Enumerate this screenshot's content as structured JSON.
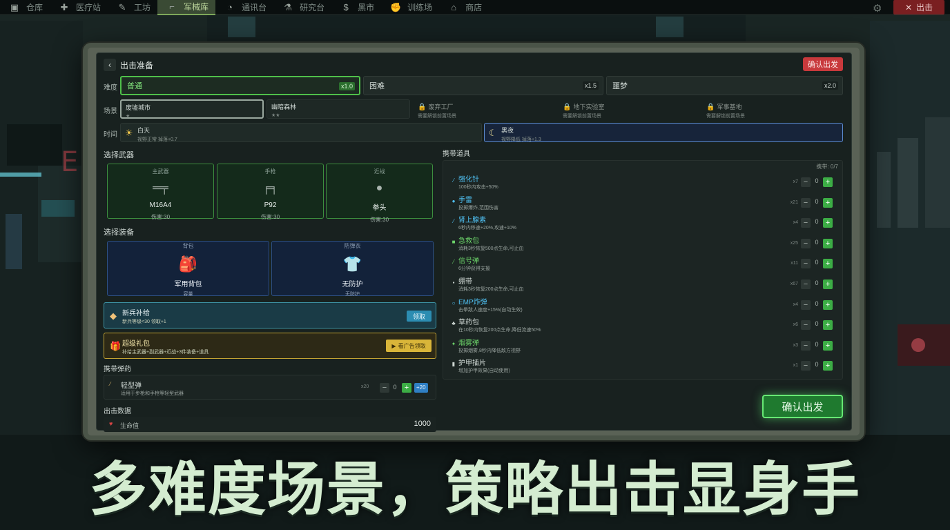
{
  "nav": {
    "items": [
      {
        "label": "仓库",
        "icon": "box-icon",
        "glyph": "▣"
      },
      {
        "label": "医疗站",
        "icon": "medical-bag-icon",
        "glyph": "✚"
      },
      {
        "label": "工坊",
        "icon": "wrench-icon",
        "glyph": "✎"
      },
      {
        "label": "军械库",
        "icon": "rifle-icon",
        "glyph": "⌐"
      },
      {
        "label": "通讯台",
        "icon": "satellite-dish-icon",
        "glyph": "◔"
      },
      {
        "label": "研究台",
        "icon": "microscope-icon",
        "glyph": "⚗"
      },
      {
        "label": "黑市",
        "icon": "money-bag-icon",
        "glyph": "$"
      },
      {
        "label": "训练场",
        "icon": "muscle-arm-icon",
        "glyph": "✊"
      },
      {
        "label": "商店",
        "icon": "shop-icon",
        "glyph": "⌂"
      }
    ],
    "active_index": 3,
    "exit_label": "出击"
  },
  "panel": {
    "title": "出击准备",
    "confirm_top": "确认出发",
    "confirm_bottom": "确认出发"
  },
  "difficulty": {
    "label": "难度",
    "options": [
      {
        "name": "普通",
        "mult": "x1.0"
      },
      {
        "name": "困难",
        "mult": "x1.5"
      },
      {
        "name": "噩梦",
        "mult": "x2.0"
      }
    ],
    "selected": 0
  },
  "scene": {
    "label": "场景",
    "options": [
      {
        "name": "废墟城市",
        "sub": "★",
        "locked": false
      },
      {
        "name": "幽暗森林",
        "sub": "★★",
        "locked": false
      },
      {
        "name": "废弃工厂",
        "sub": "需要解锁前置场景",
        "locked": true
      },
      {
        "name": "地下实验室",
        "sub": "需要解锁前置场景",
        "locked": true
      },
      {
        "name": "军事基地",
        "sub": "需要解锁前置场景",
        "locked": true
      }
    ],
    "selected": 0
  },
  "time": {
    "label": "时间",
    "options": [
      {
        "name": "白天",
        "sub": "视野正常  掉落+0.7",
        "icon": "sun-icon",
        "glyph": "☀"
      },
      {
        "name": "黑夜",
        "sub": "视野降低  掉落+1.3",
        "icon": "moon-icon",
        "glyph": "☾"
      }
    ],
    "selected": 1
  },
  "weapons": {
    "title": "选择武器",
    "cards": [
      {
        "slot": "主武器",
        "name": "M16A4",
        "damage": "伤害:30",
        "icon": "assault-rifle-icon",
        "glyph": "═╤"
      },
      {
        "slot": "手枪",
        "name": "P92",
        "damage": "伤害:30",
        "icon": "pistol-icon",
        "glyph": "╒╕"
      },
      {
        "slot": "近战",
        "name": "拳头",
        "damage": "伤害:30",
        "icon": "fist-icon",
        "glyph": "●"
      }
    ]
  },
  "equipment": {
    "title": "选择装备",
    "cards": [
      {
        "slot": "背包",
        "name": "军用背包",
        "sub": "容量",
        "icon": "backpack-icon",
        "glyph": "🎒"
      },
      {
        "slot": "防弹衣",
        "name": "无防护",
        "sub": "无防护",
        "icon": "tshirt-icon",
        "glyph": "👕"
      }
    ]
  },
  "supply": {
    "title": "新兵补给",
    "desc": "新兵等级<30  领取+1",
    "button": "领取"
  },
  "gift": {
    "title": "超级礼包",
    "desc": "补给主武器+副武器+近战+3件装备+道具",
    "button": "看广告领取"
  },
  "ammo": {
    "title": "携带弹药",
    "name": "轻型弹",
    "desc": "适用于步枪和手枪等轻型武器",
    "count": "x20",
    "qty": "0",
    "plus20": "+20"
  },
  "stats": {
    "title": "出击数据",
    "label": "生命值",
    "value": "1000"
  },
  "items": {
    "title": "携带道具",
    "capacity": "携带: 0/7",
    "list": [
      {
        "name": "强化针",
        "desc": "100秒内攻击+50%",
        "count": "x7",
        "qty": "0",
        "color": "#4fc1f3",
        "icon": "syringe-icon",
        "glyph": "⁄"
      },
      {
        "name": "手雷",
        "desc": "投掷爆炸,范围伤害",
        "count": "x21",
        "qty": "0",
        "color": "#4fc1f3",
        "icon": "grenade-icon",
        "glyph": "●"
      },
      {
        "name": "肾上腺素",
        "desc": "6秒内移速+20%,攻速+10%",
        "count": "x4",
        "qty": "0",
        "color": "#4fc1f3",
        "icon": "syringe-icon",
        "glyph": "⁄"
      },
      {
        "name": "急救包",
        "desc": "消耗3秒恢复500点生命,可止血",
        "count": "x25",
        "qty": "0",
        "color": "#6cd36a",
        "icon": "medkit-icon",
        "glyph": "■"
      },
      {
        "name": "信号弹",
        "desc": "6分钟获得支援",
        "count": "x11",
        "qty": "0",
        "color": "#6cd36a",
        "icon": "flare-icon",
        "glyph": "⁄"
      },
      {
        "name": "绷带",
        "desc": "消耗3秒恢复200点生命,可止血",
        "count": "x67",
        "qty": "0",
        "color": "#cfd8d4",
        "icon": "bandage-icon",
        "glyph": "▪"
      },
      {
        "name": "EMP炸弹",
        "desc": "击晕敌人速度+15%(自动生效)",
        "count": "x4",
        "qty": "0",
        "color": "#4fc1f3",
        "icon": "emp-ring-icon",
        "glyph": "○"
      },
      {
        "name": "草药包",
        "desc": "在10秒内恢复200点生命,降低流速50%",
        "count": "x6",
        "qty": "0",
        "color": "#cfd8d4",
        "icon": "herb-icon",
        "glyph": "♣"
      },
      {
        "name": "烟雾弹",
        "desc": "投掷烟雾,8秒内降低敌方视野",
        "count": "x3",
        "qty": "0",
        "color": "#6cd36a",
        "icon": "smoke-icon",
        "glyph": "✦"
      },
      {
        "name": "护甲插片",
        "desc": "增加护甲效果(自动使用)",
        "count": "x1",
        "qty": "0",
        "color": "#cfd8d4",
        "icon": "armor-plate-icon",
        "glyph": "▮"
      }
    ]
  },
  "slogan": "多难度场景，策略出击显身手",
  "colors": {
    "accent_green": "#4fbf4a",
    "danger_red": "#c8393c",
    "gold": "#d9b539",
    "teal": "#2c8db2"
  }
}
